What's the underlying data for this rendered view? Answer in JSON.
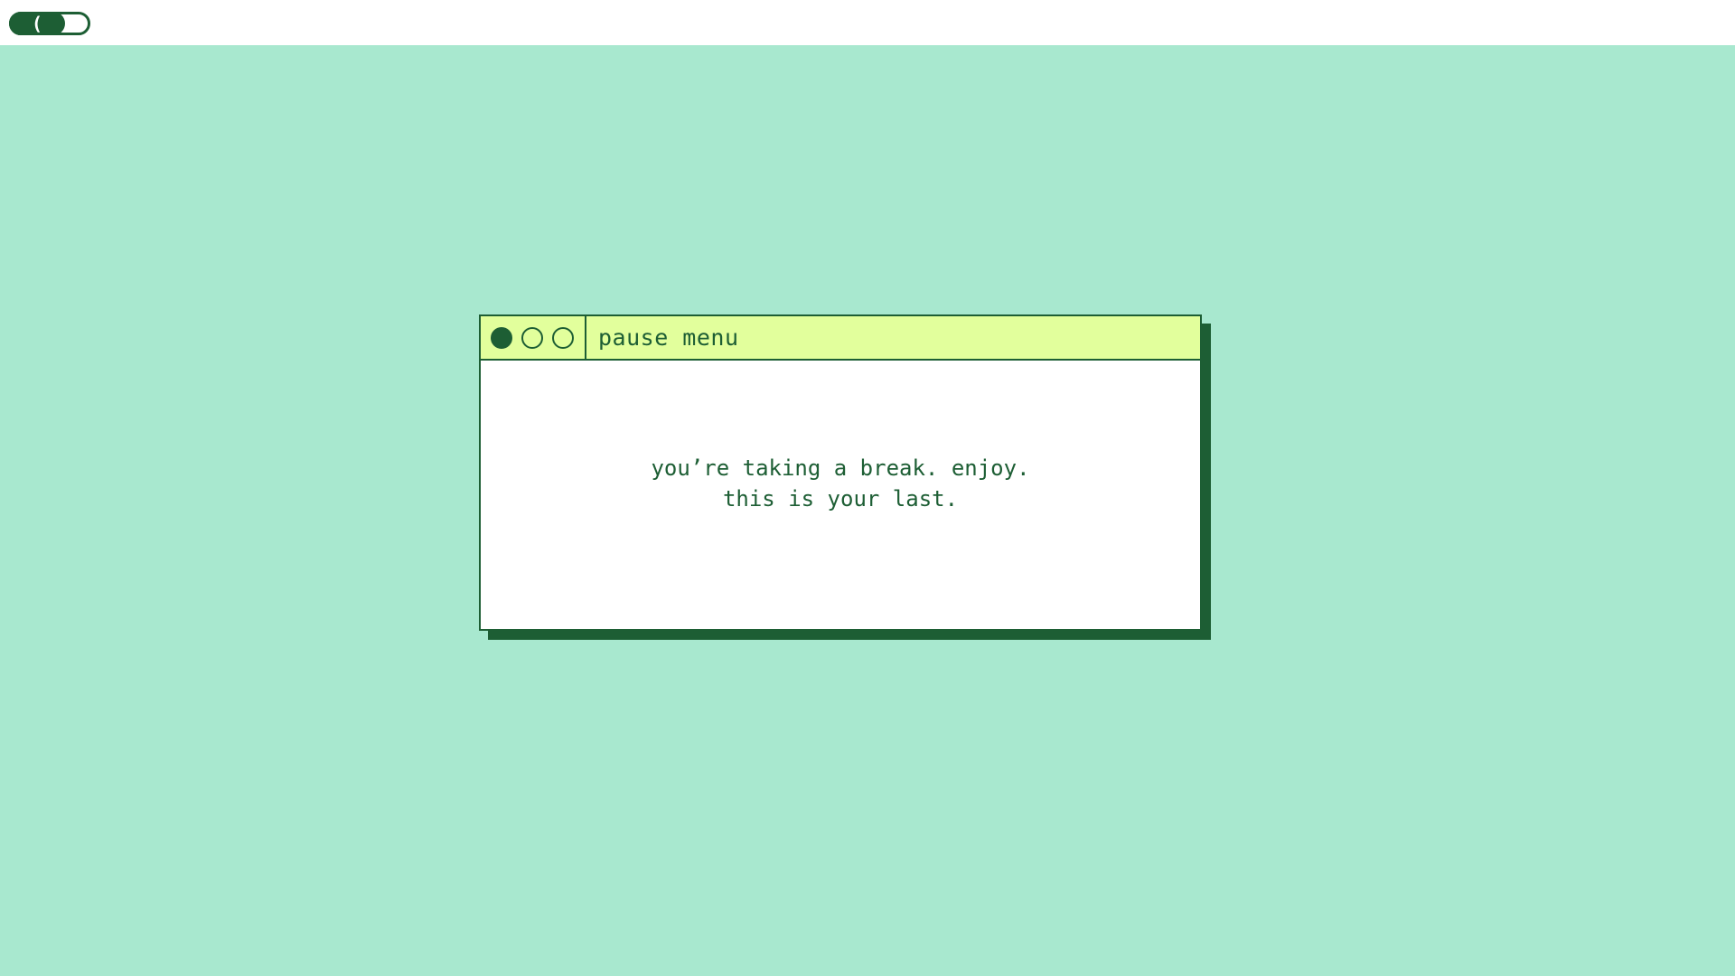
{
  "topbar": {
    "toggle": {
      "knob_glyph": "(",
      "state": "on",
      "color": "#1d5e34"
    }
  },
  "window": {
    "title": "pause menu",
    "controls": [
      {
        "icon": "circle-filled-icon"
      },
      {
        "icon": "circle-outline-icon"
      },
      {
        "icon": "circle-outline-icon"
      }
    ],
    "message_line_1": "you’re taking a break. enjoy.",
    "message_line_2": "this is your last."
  },
  "colors": {
    "background": "#a8e8cf",
    "titlebar": "#e2ff9c",
    "accent": "#1d5e34",
    "panel": "#ffffff"
  }
}
